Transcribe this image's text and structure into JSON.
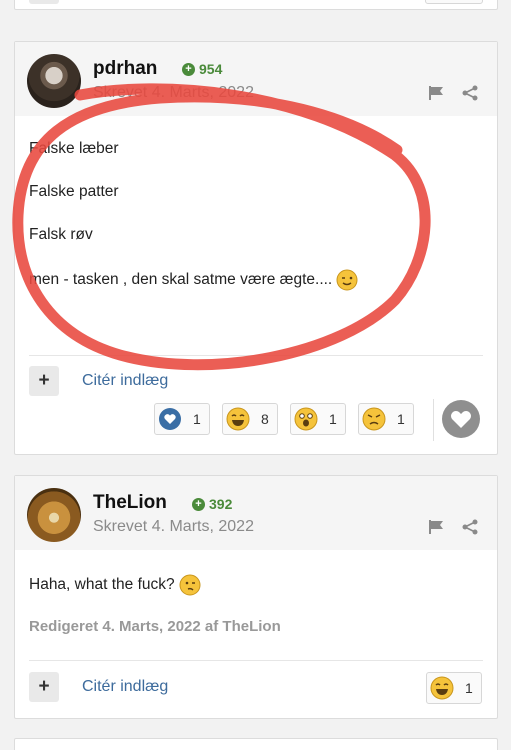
{
  "posts": [
    {
      "author": "pdrhan",
      "reputation": "954",
      "posted": "Skrevet 4. Marts, 2022",
      "lines": [
        "Falske læber",
        "Falske patter",
        "Falsk røv",
        "men - tasken , den skal satme være ægte...."
      ],
      "quote_label": "Citér indlæg",
      "reactions": [
        {
          "icon": "heart-reaction-icon",
          "count": "1"
        },
        {
          "icon": "laugh-reaction-icon",
          "count": "8"
        },
        {
          "icon": "shocked-reaction-icon",
          "count": "1"
        },
        {
          "icon": "angry-reaction-icon",
          "count": "1"
        }
      ]
    },
    {
      "author": "TheLion",
      "reputation": "392",
      "posted": "Skrevet 4. Marts, 2022",
      "lines": [
        "Haha, what the fuck?"
      ],
      "edited": "Redigeret 4. Marts, 2022 af TheLion",
      "quote_label": "Citér indlæg",
      "reactions": [
        {
          "icon": "laugh-reaction-icon",
          "count": "1"
        }
      ]
    }
  ],
  "colors": {
    "annotation": "#e8483e",
    "reputation": "#4a8a3a",
    "link": "#3d6b9c"
  }
}
